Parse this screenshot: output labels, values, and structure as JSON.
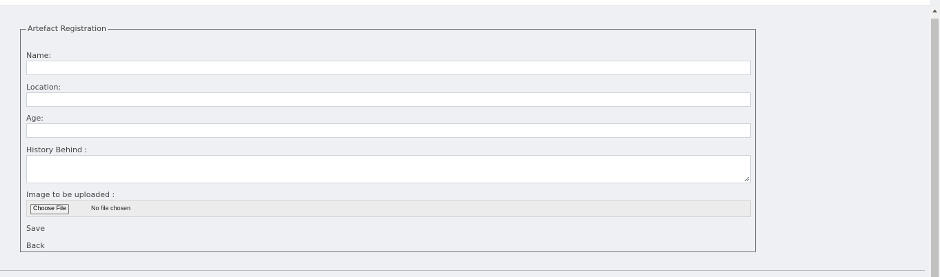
{
  "form": {
    "legend": "Artefact Registration",
    "fields": {
      "name_label": "Name:",
      "name_value": "",
      "location_label": "Location:",
      "location_value": "",
      "age_label": "Age:",
      "age_value": "",
      "history_label": "History Behind :",
      "history_value": "",
      "image_label": "Image to be uploaded :"
    },
    "file_input": {
      "button_label": "Choose File",
      "status": "No file chosen"
    },
    "actions": {
      "save_label": "Save",
      "back_label": "Back"
    }
  },
  "icons": {
    "scroll_up": "triangle-up-icon",
    "resize_grip": "resize-grip-icon"
  },
  "colors": {
    "page_background": "#eff0f4",
    "border": "#6c6c6c",
    "scroll_thumb": "#c1c1c1"
  }
}
